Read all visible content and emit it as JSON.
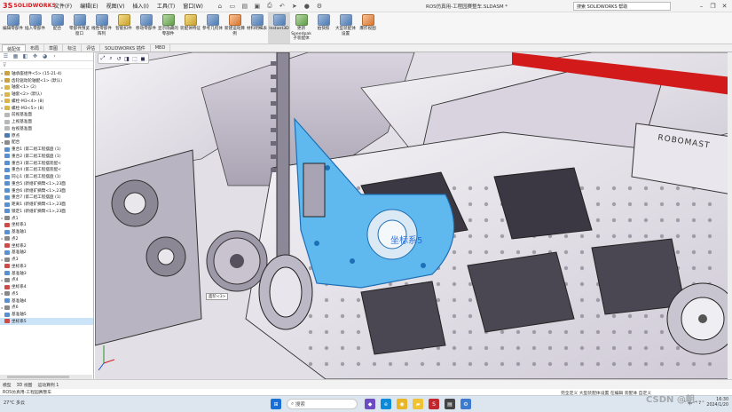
{
  "app": {
    "logo_mark": "3S",
    "logo_text": "SOLIDWORKS",
    "doc_title": "ROS仿真用-工程园赛整车.SLDASM *",
    "search_placeholder": "搜索 SOLIDWORKS 帮助"
  },
  "menu": [
    "文件(F)",
    "编辑(E)",
    "视图(V)",
    "插入(I)",
    "工具(T)",
    "窗口(W)"
  ],
  "quick_access": [
    "home-icon",
    "new-icon",
    "open-icon",
    "save-icon",
    "print-icon",
    "undo-icon",
    "select-icon",
    "rebuild-icon",
    "options-icon"
  ],
  "window_controls": [
    "minimize",
    "restore",
    "close"
  ],
  "ribbon": [
    {
      "label": "编辑零部件",
      "color": "blue"
    },
    {
      "label": "插入零部件",
      "color": "blue"
    },
    {
      "label": "配合",
      "color": "blue"
    },
    {
      "label": "零部件预览窗口",
      "color": "blue"
    },
    {
      "label": "线性零部件阵列",
      "color": "blue"
    },
    {
      "label": "智能扣件",
      "color": "yellow"
    },
    {
      "label": "移动零部件",
      "color": "blue"
    },
    {
      "label": "显示隐藏的零部件",
      "color": "green"
    },
    {
      "label": "装配体特征",
      "color": "yellow"
    },
    {
      "label": "参考几何体",
      "color": "blue"
    },
    {
      "label": "新建运动算例",
      "color": "orange"
    },
    {
      "label": "材料明细表",
      "color": "blue"
    },
    {
      "label": "Instant3D",
      "color": "blue"
    },
    {
      "label": "更新Speedpak子装配体",
      "color": "green"
    },
    {
      "label": "拍快照",
      "color": "blue"
    },
    {
      "label": "大型装配体设置",
      "color": "blue"
    },
    {
      "label": "爆炸视图",
      "color": "orange"
    }
  ],
  "tabs": [
    "装配体",
    "布局",
    "草图",
    "标注",
    "评估",
    "SOLIDWORKS 插件",
    "MBD"
  ],
  "feature_tree": [
    {
      "label": "轴承座组件<5> (15-21-4)",
      "expand": "▸",
      "icon": "#c9a343"
    },
    {
      "label": "齿轮驱动轮轴配<1> (默认)",
      "expand": "▸",
      "icon": "#c9a343"
    },
    {
      "label": "轴套<1> (2)",
      "expand": "▸",
      "icon": "#d8b64c"
    },
    {
      "label": "轴套<2> (默认)",
      "expand": "▸",
      "icon": "#d8b64c"
    },
    {
      "label": "螺栓-M3<4> (8)",
      "expand": "▸",
      "icon": "#d8b64c"
    },
    {
      "label": "螺栓-M3<5> (8)",
      "expand": "▸",
      "icon": "#d8b64c"
    },
    {
      "label": "前视基准面",
      "expand": "",
      "icon": "#b7b7b7"
    },
    {
      "label": "上视基准面",
      "expand": "",
      "icon": "#b7b7b7"
    },
    {
      "label": "右视基准面",
      "expand": "",
      "icon": "#b7b7b7"
    },
    {
      "label": "原点",
      "expand": "",
      "icon": "#4d7bb5"
    },
    {
      "label": "配合",
      "expand": "▾",
      "icon": "#8c8c8c"
    },
    {
      "label": "重合1 (第二组工程摆盘 (1)",
      "expand": "",
      "icon": "#5a8fd0"
    },
    {
      "label": "重合2 (第二组工程摆盘 (1)",
      "expand": "",
      "icon": "#5a8fd0"
    },
    {
      "label": "重合3 (第二组工程摆装配<",
      "expand": "",
      "icon": "#5a8fd0"
    },
    {
      "label": "重合4 (第二组工程摆装配<",
      "expand": "",
      "icon": "#5a8fd0"
    },
    {
      "label": "同心1 (第二组工程摆盘 (1)",
      "expand": "",
      "icon": "#5a8fd0"
    },
    {
      "label": "重合5 (新组矿摘臂<1>,23面",
      "expand": "",
      "icon": "#5a8fd0"
    },
    {
      "label": "重合6 (新组矿摘臂<1>,23面",
      "expand": "",
      "icon": "#5a8fd0"
    },
    {
      "label": "重合7 (第二组工程摆盘 (1)",
      "expand": "",
      "icon": "#5a8fd0"
    },
    {
      "label": "距离1 (新组矿摘臂<1>,23面",
      "expand": "",
      "icon": "#5a8fd0"
    },
    {
      "label": "锁定1 (新组矿摘臂<1>,23面",
      "expand": "",
      "icon": "#5a8fd0"
    },
    {
      "label": "点1",
      "expand": "▸",
      "icon": "#888888"
    },
    {
      "label": "坐标系1",
      "expand": "",
      "icon": "#d04a4a"
    },
    {
      "label": "基准轴1",
      "expand": "",
      "icon": "#5a8fd0"
    },
    {
      "label": "点2",
      "expand": "▸",
      "icon": "#888888"
    },
    {
      "label": "坐标系2",
      "expand": "",
      "icon": "#d04a4a"
    },
    {
      "label": "基准轴2",
      "expand": "",
      "icon": "#5a8fd0"
    },
    {
      "label": "点3",
      "expand": "▸",
      "icon": "#888888"
    },
    {
      "label": "坐标系3",
      "expand": "",
      "icon": "#d04a4a"
    },
    {
      "label": "基准轴3",
      "expand": "",
      "icon": "#5a8fd0"
    },
    {
      "label": "点4",
      "expand": "▸",
      "icon": "#888888"
    },
    {
      "label": "坐标系4",
      "expand": "",
      "icon": "#d04a4a"
    },
    {
      "label": "点5",
      "expand": "▸",
      "icon": "#888888"
    },
    {
      "label": "基准轴4",
      "expand": "",
      "icon": "#5a8fd0"
    },
    {
      "label": "点6",
      "expand": "▸",
      "icon": "#888888"
    },
    {
      "label": "基准轴5",
      "expand": "",
      "icon": "#5a8fd0"
    },
    {
      "label": "坐标系5",
      "expand": "",
      "icon": "#d04a4a",
      "selected": true
    }
  ],
  "viewport": {
    "coord_label": "坐标系5",
    "plate_label": "面阶<3>",
    "panel_text": "ROBOMAST"
  },
  "bottom_tabs": [
    "模型",
    "3D 视图",
    "运动算例 1"
  ],
  "status": {
    "left": "ROS仿真用-工程园赛整车",
    "mode": "完全定义  大型装配体设置  在编辑 装配体  ",
    "unit": "自定义"
  },
  "taskbar": {
    "weather": "27°C 多云",
    "search": "搜索",
    "apps": [
      "windows",
      "search",
      "widget",
      "edge",
      "chrome",
      "files",
      "solidworks",
      "explorer",
      "settings"
    ]
  },
  "tray": {
    "lang": "中",
    "time": "16:30",
    "date": "2024/1/20"
  },
  "watermark": "CSDN @朝..."
}
